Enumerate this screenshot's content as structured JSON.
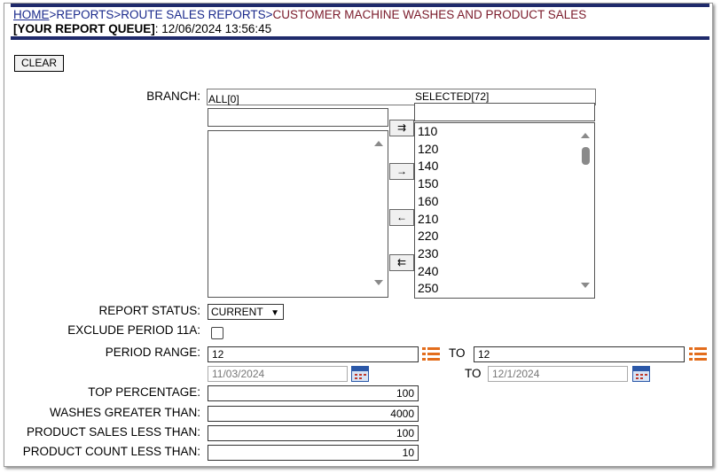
{
  "breadcrumb": {
    "home": "HOME",
    "sep": ">",
    "reports": "REPORTS",
    "route_sales": "ROUTE SALES REPORTS",
    "current": "CUSTOMER MACHINE WASHES AND PRODUCT SALES"
  },
  "queue": {
    "label": "[YOUR REPORT QUEUE]",
    "timestamp": ": 12/06/2024 13:56:45"
  },
  "clear_button": "CLEAR",
  "branch": {
    "label": "BRANCH:",
    "all_header": "ALL[0]",
    "selected_header": "SELECTED[72]",
    "selected_items": [
      "110",
      "120",
      "140",
      "150",
      "160",
      "210",
      "220",
      "230",
      "240",
      "250"
    ],
    "move_buttons": [
      "⇉",
      "→",
      "←",
      "⇇"
    ]
  },
  "report_status": {
    "label": "REPORT STATUS:",
    "value": "CURRENT"
  },
  "exclude_period": {
    "label": "EXCLUDE PERIOD 11A:",
    "checked": false
  },
  "period_range": {
    "label": "PERIOD RANGE:",
    "from": "12",
    "to_label": "TO",
    "to": "12",
    "from_date": "11/03/2024",
    "to_date_label": "TO",
    "to_date": "12/1/2024"
  },
  "top_percentage": {
    "label": "TOP PERCENTAGE:",
    "value": "100"
  },
  "washes_greater": {
    "label": "WASHES GREATER THAN:",
    "value": "4000"
  },
  "product_sales_less": {
    "label": "PRODUCT SALES LESS THAN:",
    "value": "100"
  },
  "product_count_less": {
    "label": "PRODUCT COUNT LESS THAN:",
    "value": "10"
  },
  "colors": {
    "nav_bar": "#1f2a6b",
    "link": "#1a2a8c",
    "current_crumb": "#7a1a2a",
    "icon_orange": "#e36d1c"
  }
}
